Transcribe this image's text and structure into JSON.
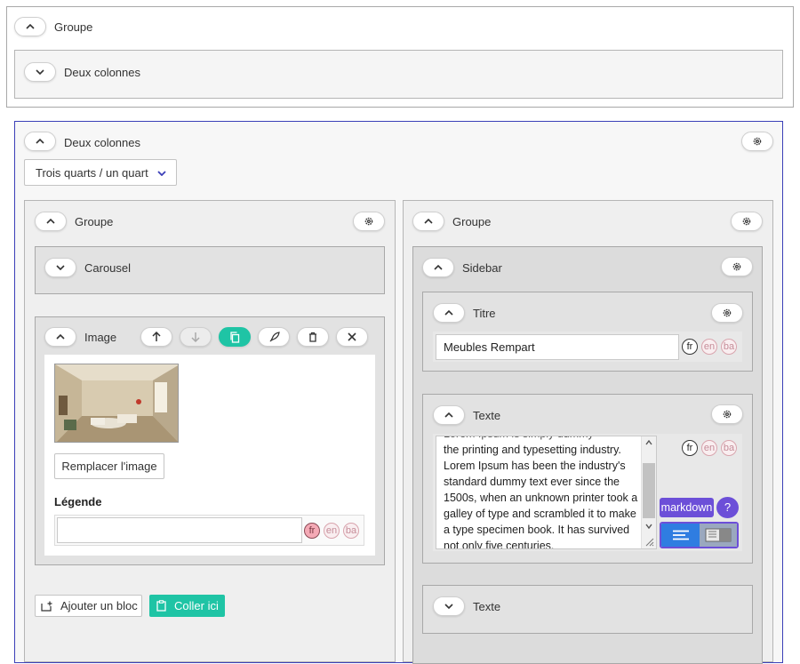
{
  "top_group": {
    "label": "Groupe",
    "collapsed_block": {
      "label": "Deux colonnes"
    }
  },
  "two_columns": {
    "label": "Deux colonnes",
    "layout_select": "Trois quarts / un quart",
    "left_column": {
      "group_label": "Groupe",
      "carousel_label": "Carousel",
      "image_block": {
        "label": "Image",
        "replace_button": "Remplacer l'image",
        "caption_label": "Légende",
        "caption_value": "",
        "langs": [
          "fr",
          "en",
          "ba"
        ]
      },
      "add_block_button": "Ajouter un bloc",
      "paste_button": "Coller ici"
    },
    "right_column": {
      "group_label": "Groupe",
      "sidebar": {
        "label": "Sidebar",
        "title_block": {
          "label": "Titre",
          "value": "Meubles Rempart",
          "langs": [
            "fr",
            "en",
            "ba"
          ]
        },
        "text_block": {
          "label": "Texte",
          "lines": [
            "the printing and typesetting industry.",
            "Lorem Ipsum has been the industry's",
            "standard dummy text ever since the",
            "1500s, when an unknown printer took a",
            "galley of type and scrambled it to make",
            "a type specimen book. It has survived",
            "not only five centuries."
          ],
          "langs": [
            "fr",
            "en",
            "ba"
          ],
          "markdown_label": "markdown",
          "help_label": "?"
        },
        "collapsed_text_label": "Texte"
      }
    }
  },
  "colors": {
    "teal": "#1fc4a5",
    "active_outline": "#3b3fb8",
    "markdown_purple": "#6c4fd8",
    "toggle_blue": "#2f7de1"
  }
}
